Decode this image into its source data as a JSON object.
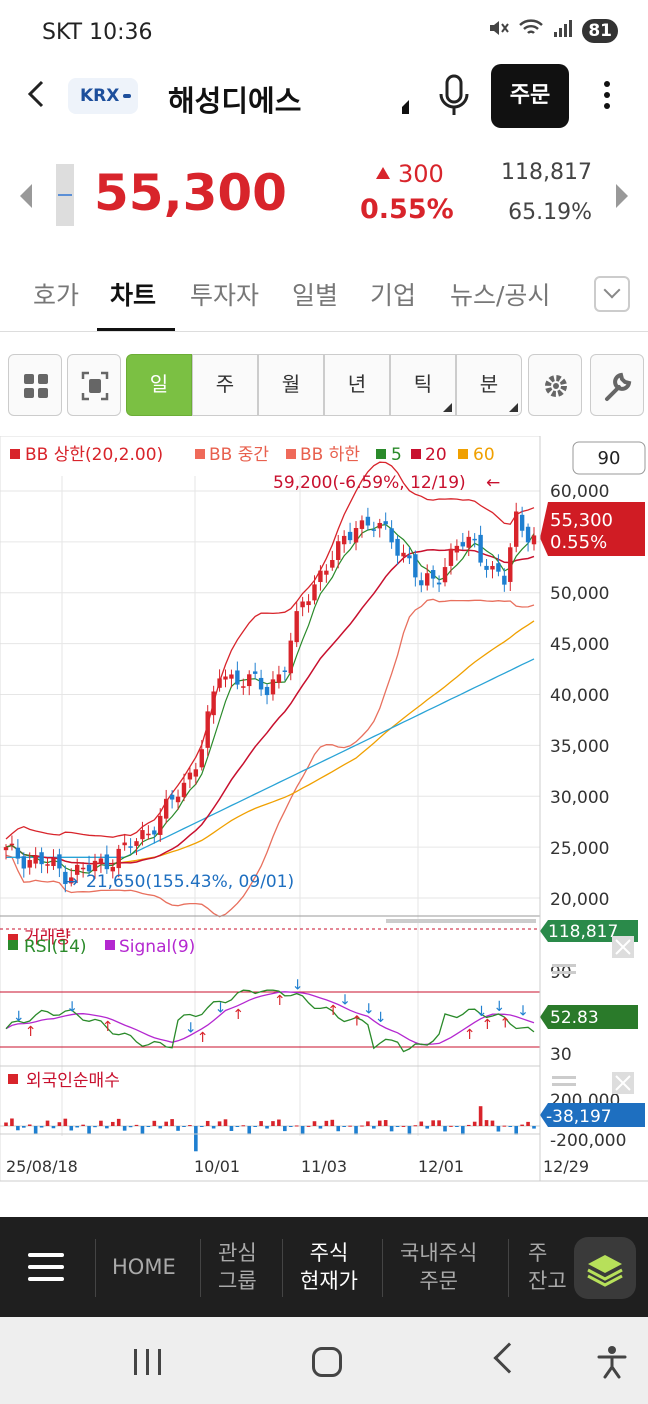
{
  "status_bar": {
    "carrier_time": "SKT 10:36",
    "battery": "81"
  },
  "header": {
    "exchange_badge": "KRX",
    "stock_name": "해성디에스",
    "order_label": "주문"
  },
  "quote": {
    "price": "55,300",
    "change": "300",
    "change_pct": "0.55%",
    "volume": "118,817",
    "volume_pct": "65.19%",
    "up_color": "#d8242b"
  },
  "tabs": [
    {
      "label": "호가"
    },
    {
      "label": "차트"
    },
    {
      "label": "투자자"
    },
    {
      "label": "일별"
    },
    {
      "label": "기업"
    },
    {
      "label": "뉴스/공시"
    }
  ],
  "toolbar": {
    "periods": [
      {
        "label": "일",
        "active": true
      },
      {
        "label": "주"
      },
      {
        "label": "월"
      },
      {
        "label": "년"
      },
      {
        "label": "틱"
      },
      {
        "label": "분"
      }
    ]
  },
  "chart": {
    "legend": {
      "bb_upper": "BB 상한(20,2.00)",
      "bb_mid": "BB 중간",
      "bb_lower": "BB 하한",
      "ma5": "5",
      "ma20": "20",
      "ma60": "60"
    },
    "count_box": "90",
    "high_annotation": "59,200(-6.59%, 12/19)",
    "low_annotation": "21,650(155.43%, 09/01)",
    "price_tag": {
      "price": "55,300",
      "pct": "0.55%"
    },
    "y_ticks": [
      "60,000",
      "55,000",
      "50,000",
      "45,000",
      "40,000",
      "35,000",
      "30,000",
      "25,000",
      "20,000"
    ],
    "volume_panel": {
      "label": "거래량",
      "value": "118,817"
    },
    "rsi_panel": {
      "rsi_label": "RSI(14)",
      "signal_label": "Signal(9)",
      "tick_90": "90",
      "tick_30": "30",
      "value": "52.83"
    },
    "foreign_panel": {
      "label": "외국인순매수",
      "tick_top": "200,000",
      "tick_bottom": "-200,000",
      "value": "-38,197"
    },
    "x_ticks": [
      "25/08/18",
      "10/01",
      "11/03",
      "12/01",
      "12/29"
    ],
    "colors": {
      "up": "#d8242b",
      "down": "#1e7fd0",
      "bb": "#d8242b",
      "ma5": "#2a8a2a",
      "ma20": "#c8102e",
      "ma60": "#f0a000",
      "ma120": "#29a3d6",
      "rsi": "#2a8a2a",
      "signal": "#b428d0"
    }
  },
  "chart_data": {
    "type": "candlestick",
    "x_labels": [
      "25/08/18",
      "10/01",
      "11/03",
      "12/01",
      "12/29"
    ],
    "ylim": [
      18000,
      62000
    ],
    "last_close": 55300,
    "period_high": {
      "value": 59200,
      "date": "12/19"
    },
    "period_low": {
      "value": 21650,
      "date": "09/01"
    },
    "series": [
      {
        "name": "5",
        "type": "line"
      },
      {
        "name": "20",
        "type": "line"
      },
      {
        "name": "60",
        "type": "line"
      }
    ],
    "rsi": {
      "last": 52.83,
      "levels": [
        90,
        30
      ]
    },
    "volume_last": 118817,
    "foreign_net_last": -38197
  },
  "bottom_nav": {
    "items": [
      {
        "label": "HOME"
      },
      {
        "label": "관심\n그룹"
      },
      {
        "label": "주식\n현재가"
      },
      {
        "label": "국내주식\n주문"
      },
      {
        "label": "주\n잔고"
      }
    ]
  }
}
